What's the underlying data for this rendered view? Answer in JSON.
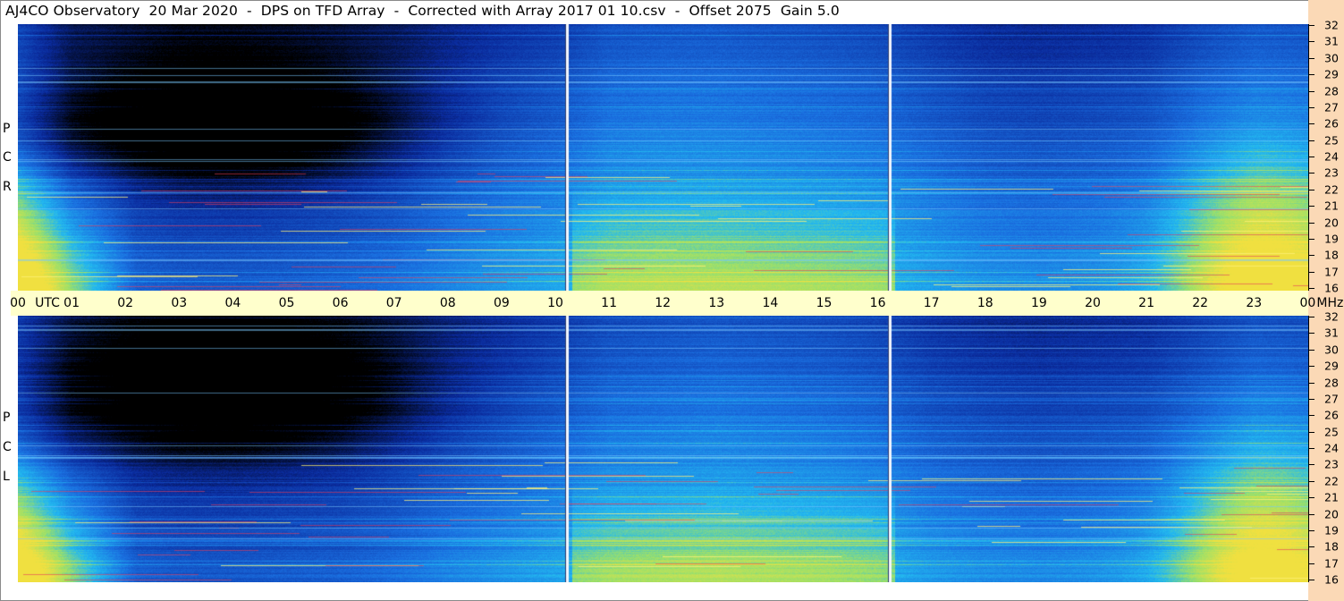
{
  "title": "AJ4CO Observatory  20 Mar 2020  -  DPS on TFD Array  -  Corrected with Array 2017 01 10.csv  -  Offset 2075  Gain 5.0",
  "panels": [
    {
      "id": "rcp",
      "letters": [
        "P",
        "C",
        "R"
      ]
    },
    {
      "id": "lcp",
      "letters": [
        "P",
        "C",
        "L"
      ]
    }
  ],
  "time_axis": {
    "labels": [
      "00",
      "UTC",
      "01",
      "02",
      "03",
      "04",
      "05",
      "06",
      "07",
      "08",
      "09",
      "10",
      "11",
      "12",
      "13",
      "14",
      "15",
      "16",
      "17",
      "18",
      "19",
      "20",
      "21",
      "22",
      "23",
      "00",
      "MHz"
    ]
  },
  "freq_axis": {
    "labels": [
      "32",
      "31",
      "30",
      "29",
      "28",
      "27",
      "26",
      "25",
      "24",
      "23",
      "22",
      "21",
      "20",
      "19",
      "18",
      "17",
      "16"
    ]
  },
  "colors": {
    "background_low": "#000000",
    "deep_blue": "#0a2a9c",
    "mid_blue": "#1a6fe0",
    "cyan": "#22b8f0",
    "high_green": "#9be06a",
    "peak_yellow": "#f0e040",
    "timebar": "#ffffcc",
    "scale_bg": "#fbd9b6"
  },
  "chart_data": {
    "type": "heatmap",
    "title": "AJ4CO Observatory  20 Mar 2020  -  DPS on TFD Array  -  Corrected with Array 2017 01 10.csv  -  Offset 2075  Gain 5.0",
    "xlabel": "UTC",
    "ylabel": "MHz",
    "x_range": [
      "00",
      "00"
    ],
    "y_range": [
      16,
      32
    ],
    "x_ticks": [
      "00",
      "01",
      "02",
      "03",
      "04",
      "05",
      "06",
      "07",
      "08",
      "09",
      "10",
      "11",
      "12",
      "13",
      "14",
      "15",
      "16",
      "17",
      "18",
      "19",
      "20",
      "21",
      "22",
      "23",
      "00"
    ],
    "y_ticks": [
      32,
      31,
      30,
      29,
      28,
      27,
      26,
      25,
      24,
      23,
      22,
      21,
      20,
      19,
      18,
      17,
      16
    ],
    "series": [
      {
        "name": "RCP",
        "values": [
          0.55,
          0.3,
          0.25,
          0.2,
          0.2,
          0.22,
          0.25,
          0.3,
          0.38,
          0.45,
          0.5,
          0.6,
          0.62,
          0.62,
          0.6,
          0.58,
          0.55,
          0.48,
          0.42,
          0.4,
          0.42,
          0.45,
          0.55,
          0.62,
          0.6
        ]
      },
      {
        "name": "LCP",
        "values": [
          0.5,
          0.28,
          0.22,
          0.18,
          0.18,
          0.2,
          0.22,
          0.28,
          0.36,
          0.42,
          0.48,
          0.56,
          0.58,
          0.6,
          0.58,
          0.56,
          0.52,
          0.44,
          0.4,
          0.38,
          0.4,
          0.42,
          0.5,
          0.58,
          0.56
        ]
      }
    ]
  }
}
